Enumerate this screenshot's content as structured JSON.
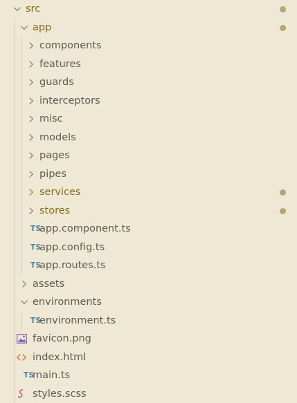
{
  "explorer": {
    "items": [
      {
        "label": "src",
        "kind": "folder",
        "expanded": true,
        "depth": 0,
        "modified": true
      },
      {
        "label": "app",
        "kind": "folder",
        "expanded": true,
        "depth": 1,
        "modified": true
      },
      {
        "label": "components",
        "kind": "folder",
        "expanded": false,
        "depth": 2,
        "modified": false
      },
      {
        "label": "features",
        "kind": "folder",
        "expanded": false,
        "depth": 2,
        "modified": false
      },
      {
        "label": "guards",
        "kind": "folder",
        "expanded": false,
        "depth": 2,
        "modified": false
      },
      {
        "label": "interceptors",
        "kind": "folder",
        "expanded": false,
        "depth": 2,
        "modified": false
      },
      {
        "label": "misc",
        "kind": "folder",
        "expanded": false,
        "depth": 2,
        "modified": false
      },
      {
        "label": "models",
        "kind": "folder",
        "expanded": false,
        "depth": 2,
        "modified": false
      },
      {
        "label": "pages",
        "kind": "folder",
        "expanded": false,
        "depth": 2,
        "modified": false
      },
      {
        "label": "pipes",
        "kind": "folder",
        "expanded": false,
        "depth": 2,
        "modified": false
      },
      {
        "label": "services",
        "kind": "folder",
        "expanded": false,
        "depth": 2,
        "modified": true
      },
      {
        "label": "stores",
        "kind": "folder",
        "expanded": false,
        "depth": 2,
        "modified": true
      },
      {
        "label": "app.component.ts",
        "kind": "ts",
        "depth": 2,
        "icon_text": "TS"
      },
      {
        "label": "app.config.ts",
        "kind": "ts",
        "depth": 2,
        "icon_text": "TS"
      },
      {
        "label": "app.routes.ts",
        "kind": "ts",
        "depth": 2,
        "icon_text": "TS"
      },
      {
        "label": "assets",
        "kind": "folder",
        "expanded": false,
        "depth": 1,
        "modified": false
      },
      {
        "label": "environments",
        "kind": "folder",
        "expanded": true,
        "depth": 1,
        "modified": false
      },
      {
        "label": "environment.ts",
        "kind": "ts",
        "depth": 2,
        "icon_text": "TS"
      },
      {
        "label": "favicon.png",
        "kind": "image",
        "depth": 1
      },
      {
        "label": "index.html",
        "kind": "html",
        "depth": 1
      },
      {
        "label": "main.ts",
        "kind": "ts",
        "depth": 1,
        "icon_text": "TS"
      },
      {
        "label": "styles.scss",
        "kind": "scss",
        "depth": 1
      }
    ]
  },
  "colors": {
    "background": "#eee8d5",
    "text": "#5b5c52",
    "modified_text": "#8a6a1a",
    "modified_dot": "#b7a577",
    "ts_icon": "#4a7fa3",
    "html_icon": "#d4733a",
    "scss_icon": "#c9566b",
    "image_icon": "#8a5fb0"
  },
  "icons": {
    "chevron_right": "chevron-right-icon",
    "chevron_down": "chevron-down-icon",
    "ts": "typescript-file-icon",
    "html": "html-file-icon",
    "scss": "scss-file-icon",
    "image": "image-file-icon"
  }
}
